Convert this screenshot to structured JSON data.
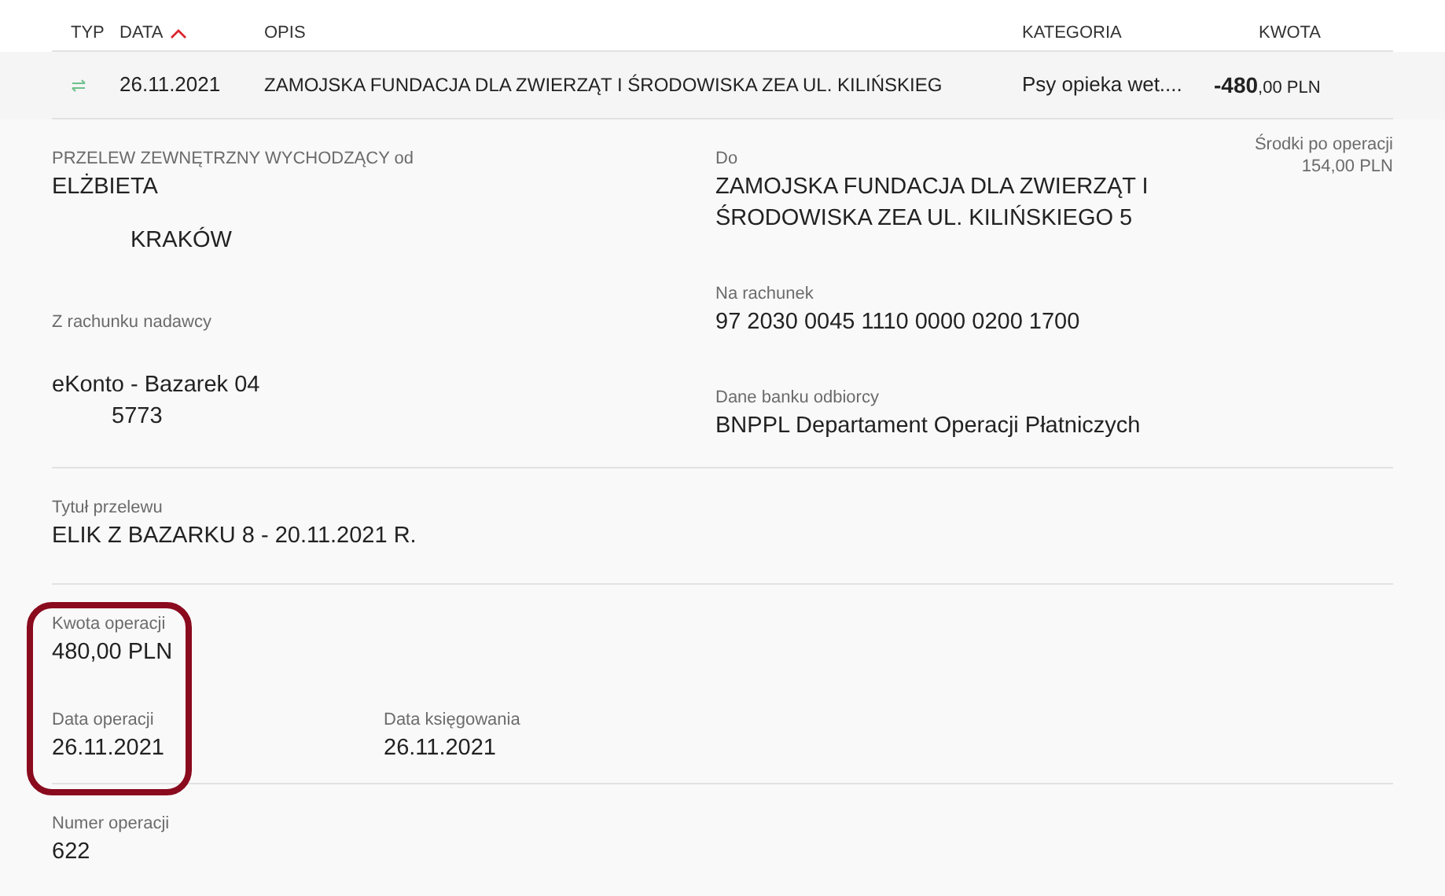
{
  "table": {
    "columns": [
      {
        "label": "TYP",
        "sorted": false
      },
      {
        "label": "DATA",
        "sorted": true
      },
      {
        "label": "OPIS",
        "sorted": false
      },
      {
        "label": "KATEGORIA",
        "sorted": false
      },
      {
        "label": "KWOTA",
        "sorted": false
      }
    ],
    "row": {
      "date": "26.11.2021",
      "description": "ZAMOJSKA FUNDACJA DLA ZWIERZĄT I ŚRODOWISKA ZEA UL. KILIŃSKIEG",
      "category": "Psy opieka wet....",
      "amount_integer": "-480",
      "amount_fraction": ",00",
      "currency": "PLN"
    }
  },
  "details": {
    "sender": {
      "label": "PRZELEW ZEWNĘTRZNY WYCHODZĄCY od",
      "name": "ELŻBIETA",
      "city": "KRAKÓW"
    },
    "sender_account": {
      "label": "Z rachunku nadawcy",
      "name": "eKonto - Bazarek 04",
      "number": "5773"
    },
    "recipient": {
      "label": "Do",
      "lines": [
        "ZAMOJSKA FUNDACJA DLA ZWIERZĄT I",
        "ŚRODOWISKA ZEA UL. KILIŃSKIEGO 5"
      ]
    },
    "recipient_account": {
      "label": "Na rachunek",
      "value": "97 2030 0045 1110 0000 0200 1700"
    },
    "recipient_bank": {
      "label": "Dane banku odbiorcy",
      "value": "BNPPL Departament Operacji Płatniczych"
    },
    "balance_after": {
      "label": "Środki po operacji",
      "value": "154,00 PLN"
    },
    "title": {
      "label": "Tytuł przelewu",
      "value": "ELIK Z BAZARKU 8 - 20.11.2021 R."
    },
    "amount": {
      "label": "Kwota operacji",
      "value": "480,00 PLN"
    },
    "operation_date": {
      "label": "Data operacji",
      "value": "26.11.2021"
    },
    "booking_date": {
      "label": "Data księgowania",
      "value": "26.11.2021"
    },
    "operation_number": {
      "label": "Numer operacji",
      "value": "622"
    }
  }
}
